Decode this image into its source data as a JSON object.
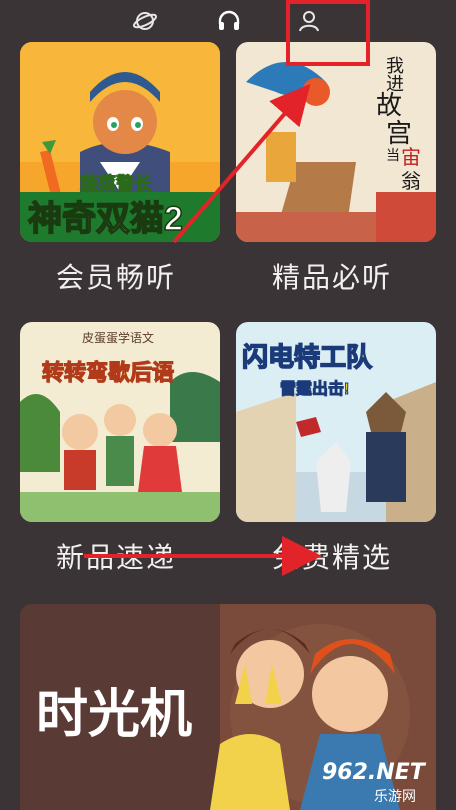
{
  "nav": {
    "icons": [
      "planet-icon",
      "headphones-icon",
      "user-icon"
    ]
  },
  "cards": [
    {
      "label": "会员畅听",
      "title_line1": "蔬菜警长",
      "title_line2": "神奇双猫2"
    },
    {
      "label": "精品必听",
      "title_chars": [
        "我",
        "进",
        "故",
        "宫",
        "当",
        "宙",
        "翁"
      ]
    },
    {
      "label": "新品速递",
      "subtitle": "皮蛋蛋学语文",
      "title": "转转弯歇后语"
    },
    {
      "label": "免费精选",
      "title": "闪电特工队",
      "subtitle": "雷霆出击!"
    }
  ],
  "banner": {
    "title": "时光机"
  },
  "watermark": {
    "main": "962.NET",
    "sub": "乐游网"
  },
  "colors": {
    "highlight": "#e2242a",
    "background": "#3a3436"
  }
}
